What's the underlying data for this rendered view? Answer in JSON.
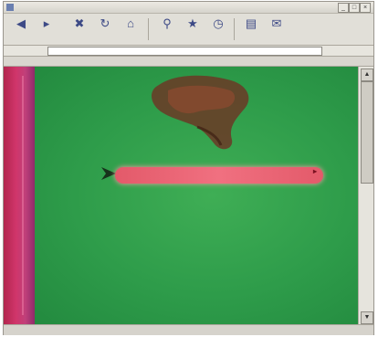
{
  "window": {
    "title": ""
  },
  "toolbar": {
    "buttons": [
      {
        "label": "",
        "icon": "back-arrow-icon"
      },
      {
        "label": "",
        "icon": "forward-arrow-icon"
      },
      {
        "label": "",
        "icon": "stop-icon"
      },
      {
        "label": "",
        "icon": "refresh-icon"
      },
      {
        "label": "",
        "icon": "home-icon"
      },
      {
        "label": "",
        "icon": "search-icon"
      },
      {
        "label": "",
        "icon": "favorites-icon"
      },
      {
        "label": "",
        "icon": "history-icon"
      },
      {
        "label": "",
        "icon": "print-icon"
      },
      {
        "label": "",
        "icon": "mail-icon"
      }
    ]
  },
  "address": {
    "label": "",
    "value": "",
    "go": ""
  },
  "links": {
    "label": "",
    "items": [
      "",
      "",
      "",
      "",
      ""
    ]
  },
  "page": {
    "sidebar_text": "",
    "heading1": "",
    "heading2": "",
    "paragraph": ""
  },
  "status": {
    "left": "",
    "center": "",
    "right": ""
  },
  "colors": {
    "page_green": "#2e9c4a",
    "sidebar_magenta": "#c0407a",
    "banner_red": "#f07080"
  }
}
